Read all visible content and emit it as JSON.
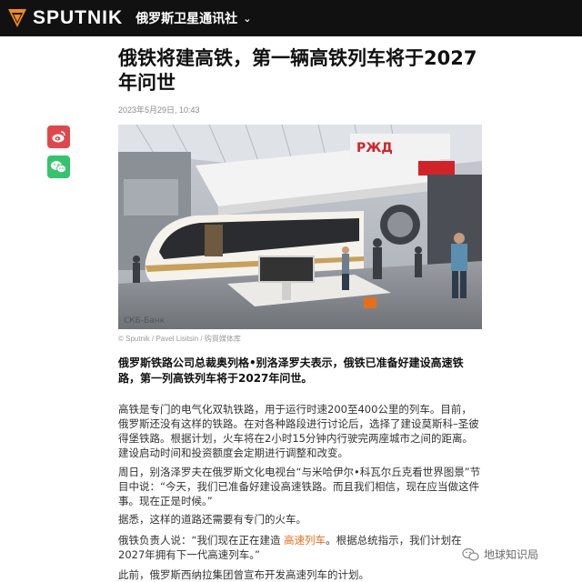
{
  "header": {
    "brand": "SPUTNIK",
    "section": "俄罗斯卫星通讯社",
    "brand_color": "#f28b1d"
  },
  "article": {
    "title": "俄铁将建高铁，第一辆高铁列车将于2027年问世",
    "date": "2023年5月29日, 10:43",
    "photo_caption": "© Sputnik / Pavel Lisitsin / 购買媒体库",
    "lead": "俄罗斯铁路公司总裁奥列格•别洛泽罗夫表示，俄铁已准备好建设高速铁路，第一列高铁列车将于2027年问世。",
    "p1": "高铁是专门的电气化双轨铁路，用于运行时速200至400公里的列车。目前，俄罗斯还没有这样的铁路。在对各种路段进行讨论后，选择了建设莫斯科–圣彼得堡铁路。根据计划，火车将在2小时15分钟内行驶完两座城市之间的距离。建设启动时间和投资额度会定期进行调整和改变。",
    "p2": "周日，别洛泽罗夫在俄罗斯文化电视台“与米哈伊尔•科瓦尔丘克看世界图景”节目中说：“今天，我们已准备好建设高速铁路。而且我们相信，现在应当做这件事。现在正是时候。”",
    "p3": "据悉，这样的道路还需要有专门的火车。",
    "p4_before": "俄铁负责人说：“我们现在正在建造 ",
    "p4_link": "高速列车",
    "p4_after": "。根据总统指示，我们计划在2027年拥有下一代高速列车。”",
    "p5": "此前，俄罗斯西纳拉集团曾宣布开发高速列车的计划。"
  },
  "share": {
    "weibo_icon": "weibo-icon",
    "wechat_icon": "wechat-icon",
    "weibo_color": "#e0474c",
    "wechat_color": "#36c36e"
  },
  "watermark": {
    "text": "地球知识局"
  }
}
